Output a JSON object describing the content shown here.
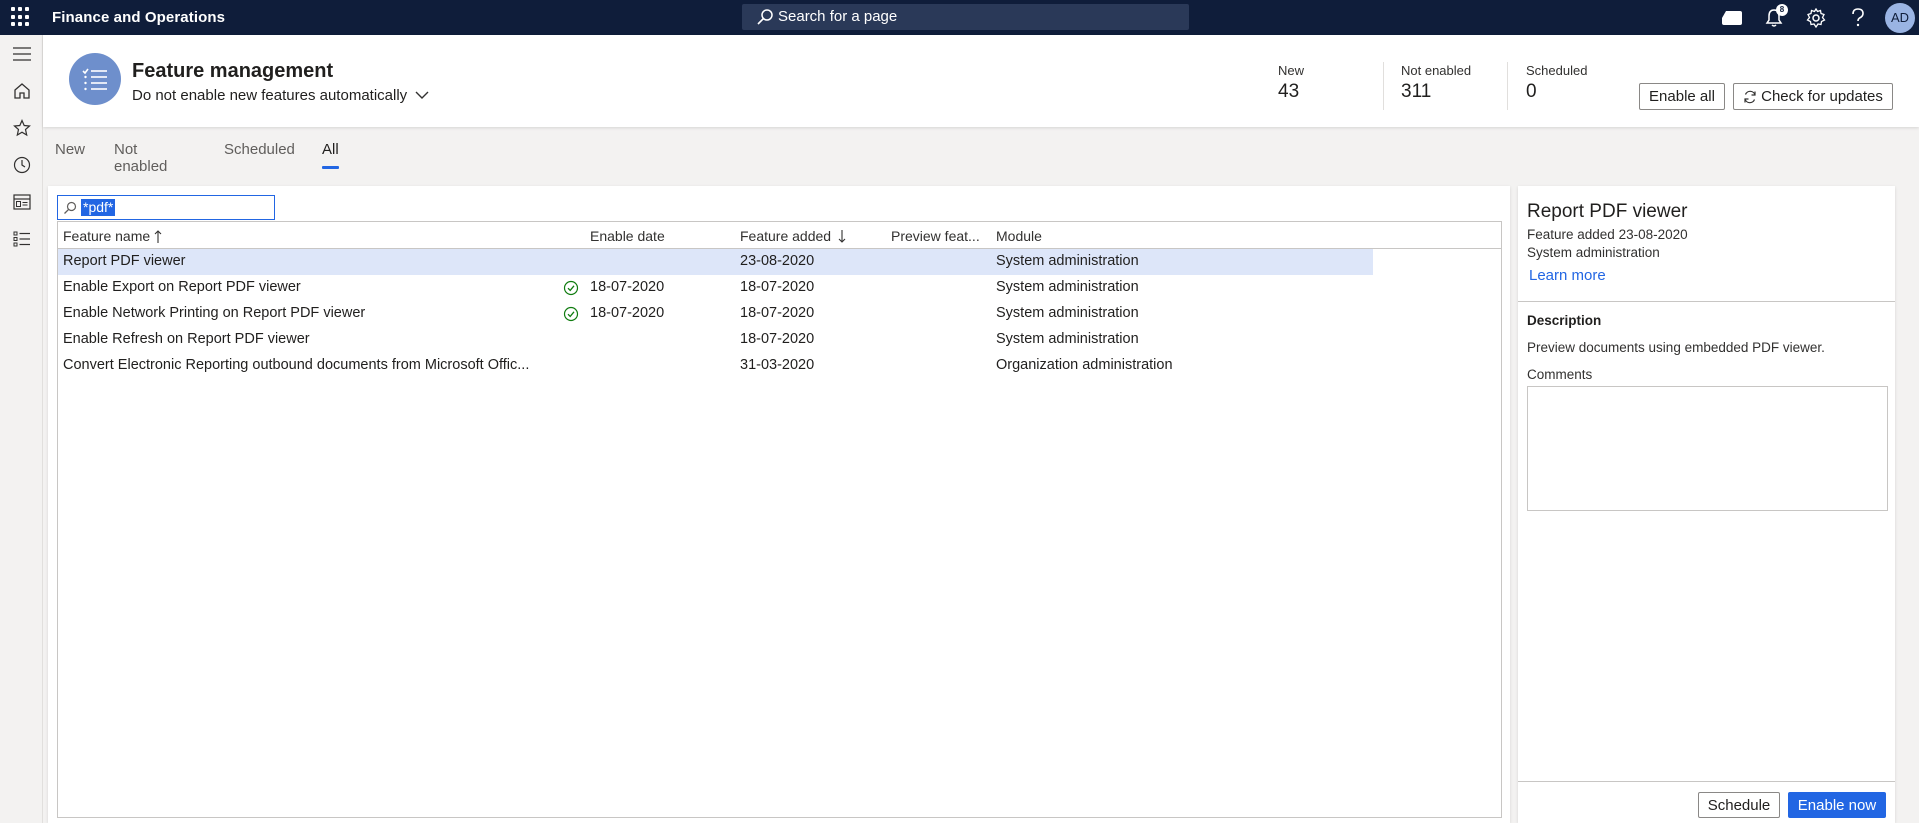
{
  "topbar": {
    "app_title": "Finance and Operations",
    "search_placeholder": "Search for a page",
    "notification_count": "8",
    "avatar_initials": "AD",
    "icons": [
      "app-launcher-icon",
      "search-icon",
      "message-icon",
      "bell-icon",
      "gear-icon",
      "help-icon"
    ]
  },
  "leftnav": {
    "icons": [
      "hamburger-icon",
      "home-icon",
      "star-icon",
      "clock-icon",
      "workspace-icon",
      "list-icon"
    ]
  },
  "header": {
    "title": "Feature management",
    "auto_enable_setting": "Do not enable new features automatically",
    "stats": [
      {
        "label": "New",
        "value": "43"
      },
      {
        "label": "Not enabled",
        "value": "311"
      },
      {
        "label": "Scheduled",
        "value": "0"
      }
    ],
    "enable_all_label": "Enable all",
    "check_updates_label": "Check for updates"
  },
  "tabs": [
    {
      "label": "New",
      "active": false
    },
    {
      "label": "Not enabled",
      "active": false
    },
    {
      "label": "Scheduled",
      "active": false
    },
    {
      "label": "All",
      "active": true
    }
  ],
  "filter": {
    "value": "*pdf*"
  },
  "table": {
    "columns": [
      "Feature name",
      "Enable date",
      "Feature added",
      "Preview feat...",
      "Module"
    ],
    "rows": [
      {
        "name": "Report PDF viewer",
        "enabled": false,
        "enable_date": "",
        "feature_added": "23-08-2020",
        "preview": "",
        "module": "System administration",
        "selected": true
      },
      {
        "name": "Enable Export on Report PDF viewer",
        "enabled": true,
        "enable_date": "18-07-2020",
        "feature_added": "18-07-2020",
        "preview": "",
        "module": "System administration",
        "selected": false
      },
      {
        "name": "Enable Network Printing on Report PDF viewer",
        "enabled": true,
        "enable_date": "18-07-2020",
        "feature_added": "18-07-2020",
        "preview": "",
        "module": "System administration",
        "selected": false
      },
      {
        "name": "Enable Refresh on Report PDF viewer",
        "enabled": false,
        "enable_date": "",
        "feature_added": "18-07-2020",
        "preview": "",
        "module": "System administration",
        "selected": false
      },
      {
        "name": "Convert Electronic Reporting outbound documents from Microsoft Offic...",
        "enabled": false,
        "enable_date": "",
        "feature_added": "31-03-2020",
        "preview": "",
        "module": "Organization administration",
        "selected": false
      }
    ]
  },
  "details": {
    "title": "Report PDF viewer",
    "feature_added": "Feature added 23-08-2020",
    "module": "System administration",
    "learn_more": "Learn more",
    "description_label": "Description",
    "description": "Preview documents using embedded PDF viewer.",
    "comments_label": "Comments",
    "comments_value": "",
    "schedule_label": "Schedule",
    "enable_now_label": "Enable now"
  },
  "colors": {
    "topbar": "#0f1d3a",
    "accent": "#2266e3",
    "selected_row": "#dde6f9",
    "enabled_check": "#107c10"
  }
}
